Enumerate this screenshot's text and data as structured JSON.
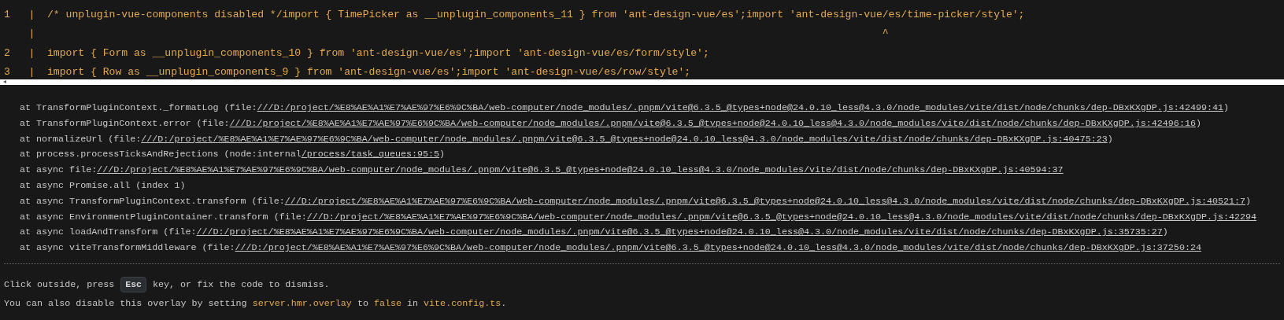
{
  "code_frame": {
    "lines": [
      {
        "number": "1",
        "separator": "|",
        "text": "/* unplugin-vue-components disabled */import { TimePicker as __unplugin_components_11 } from 'ant-design-vue/es';import 'ant-design-vue/es/time-picker/style';"
      },
      {
        "separator": "|",
        "text": "                                                                                                                                       ^"
      },
      {
        "number": "2",
        "separator": "|",
        "text": "import { Form as __unplugin_components_10 } from 'ant-design-vue/es';import 'ant-design-vue/es/form/style';"
      },
      {
        "number": "3",
        "separator": "|",
        "text": "import { Row as __unplugin_components_9 } from 'ant-design-vue/es';import 'ant-design-vue/es/row/style';"
      }
    ]
  },
  "stack": [
    {
      "before": "at TransformPluginContext._formatLog (file:",
      "link": "///D:/project/%E8%AE%A1%E7%AE%97%E6%9C%BA/web-computer/node_modules/.pnpm/vite@6.3.5_@types+node@24.0.10_less@4.3.0/node_modules/vite/dist/node/chunks/dep-DBxKXgDP.js:42499:41",
      "after": ")"
    },
    {
      "before": "at TransformPluginContext.error (file:",
      "link": "///D:/project/%E8%AE%A1%E7%AE%97%E6%9C%BA/web-computer/node_modules/.pnpm/vite@6.3.5_@types+node@24.0.10_less@4.3.0/node_modules/vite/dist/node/chunks/dep-DBxKXgDP.js:42496:16",
      "after": ")"
    },
    {
      "before": "at normalizeUrl (file:",
      "link": "///D:/project/%E8%AE%A1%E7%AE%97%E6%9C%BA/web-computer/node_modules/.pnpm/vite@6.3.5_@types+node@24.0.10_less@4.3.0/node_modules/vite/dist/node/chunks/dep-DBxKXgDP.js:40475:23",
      "after": ")"
    },
    {
      "before": "at process.processTicksAndRejections (node:internal",
      "link": "/process/task_queues:95:5",
      "after": ")"
    },
    {
      "before": "at async file:",
      "link": "///D:/project/%E8%AE%A1%E7%AE%97%E6%9C%BA/web-computer/node_modules/.pnpm/vite@6.3.5_@types+node@24.0.10_less@4.3.0/node_modules/vite/dist/node/chunks/dep-DBxKXgDP.js:40594:37"
    },
    {
      "before": "at async Promise.all (index 1)"
    },
    {
      "before": "at async TransformPluginContext.transform (file:",
      "link": "///D:/project/%E8%AE%A1%E7%AE%97%E6%9C%BA/web-computer/node_modules/.pnpm/vite@6.3.5_@types+node@24.0.10_less@4.3.0/node_modules/vite/dist/node/chunks/dep-DBxKXgDP.js:40521:7",
      "after": ")"
    },
    {
      "before": "at async EnvironmentPluginContainer.transform (file:",
      "link": "///D:/project/%E8%AE%A1%E7%AE%97%E6%9C%BA/web-computer/node_modules/.pnpm/vite@6.3.5_@types+node@24.0.10_less@4.3.0/node_modules/vite/dist/node/chunks/dep-DBxKXgDP.js:42294"
    },
    {
      "before": "at async loadAndTransform (file:",
      "link": "///D:/project/%E8%AE%A1%E7%AE%97%E6%9C%BA/web-computer/node_modules/.pnpm/vite@6.3.5_@types+node@24.0.10_less@4.3.0/node_modules/vite/dist/node/chunks/dep-DBxKXgDP.js:35735:27",
      "after": ")"
    },
    {
      "before": "at async viteTransformMiddleware (file:",
      "link": "///D:/project/%E8%AE%A1%E7%AE%97%E6%9C%BA/web-computer/node_modules/.pnpm/vite@6.3.5_@types+node@24.0.10_less@4.3.0/node_modules/vite/dist/node/chunks/dep-DBxKXgDP.js:37250:24"
    }
  ],
  "tips": [
    [
      {
        "kind": "text",
        "text": "Click outside, press "
      },
      {
        "kind": "key",
        "text": "Esc"
      },
      {
        "kind": "text",
        "text": " key, or fix the code to dismiss."
      }
    ],
    [
      {
        "kind": "text",
        "text": "You can also disable this overlay by setting "
      },
      {
        "kind": "code",
        "text": "server.hmr.overlay"
      },
      {
        "kind": "text",
        "text": " to "
      },
      {
        "kind": "code",
        "text": "false"
      },
      {
        "kind": "text",
        "text": " in "
      },
      {
        "kind": "code",
        "text": "vite.config.ts"
      },
      {
        "kind": "text",
        "text": "."
      }
    ]
  ]
}
